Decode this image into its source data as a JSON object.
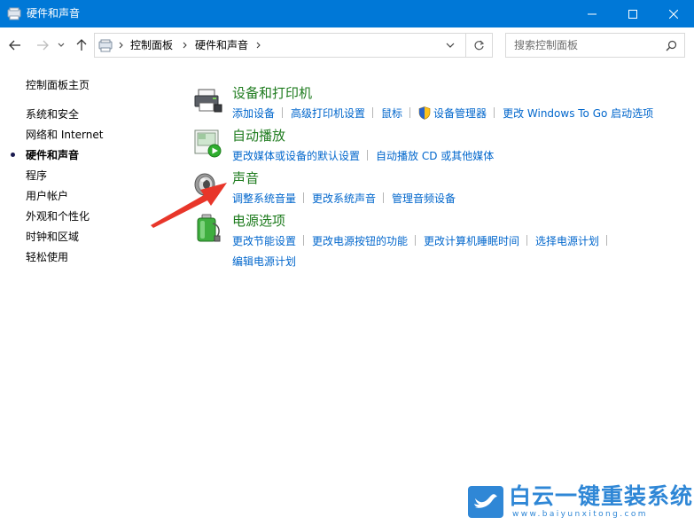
{
  "window": {
    "title": "硬件和声音",
    "icon": "control-panel-icon"
  },
  "navigation": {
    "breadcrumbs": [
      "控制面板",
      "硬件和声音"
    ],
    "search_placeholder": "搜索控制面板"
  },
  "sidebar": {
    "items": [
      {
        "label": "控制面板主页",
        "active": false
      },
      {
        "label": "系统和安全",
        "active": false
      },
      {
        "label": "网络和 Internet",
        "active": false
      },
      {
        "label": "硬件和声音",
        "active": true
      },
      {
        "label": "程序",
        "active": false
      },
      {
        "label": "用户帐户",
        "active": false
      },
      {
        "label": "外观和个性化",
        "active": false
      },
      {
        "label": "时钟和区域",
        "active": false
      },
      {
        "label": "轻松使用",
        "active": false
      }
    ]
  },
  "categories": [
    {
      "title": "设备和打印机",
      "icon": "printer-icon",
      "links": [
        "添加设备",
        "高级打印机设置",
        "鼠标",
        "设备管理器",
        "更改 Windows To Go 启动选项"
      ]
    },
    {
      "title": "自动播放",
      "icon": "autoplay-icon",
      "links": [
        "更改媒体或设备的默认设置",
        "自动播放 CD 或其他媒体"
      ]
    },
    {
      "title": "声音",
      "icon": "speaker-icon",
      "links": [
        "调整系统音量",
        "更改系统声音",
        "管理音频设备"
      ]
    },
    {
      "title": "电源选项",
      "icon": "battery-icon",
      "links": [
        "更改节能设置",
        "更改电源按钮的功能",
        "更改计算机睡眠时间",
        "选择电源计划",
        "编辑电源计划"
      ]
    }
  ],
  "watermark": {
    "title": "白云一键重装系统",
    "url": "www.baiyunxitong.com"
  },
  "colors": {
    "titlebar": "#0078d7",
    "category_title": "#1e7b1e",
    "link": "#0066cc",
    "arrow": "#e8362a",
    "watermark": "#2f87d6"
  }
}
